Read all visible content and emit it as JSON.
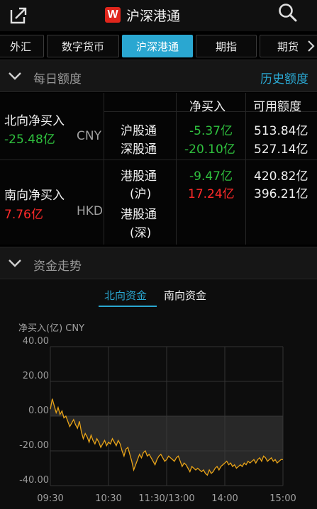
{
  "header": {
    "title": "沪深港通",
    "logo_letter": "W",
    "share_icon": "share-icon",
    "search_icon": "search-icon"
  },
  "tabs": [
    {
      "label": "外汇",
      "active": false
    },
    {
      "label": "数字货币",
      "active": false
    },
    {
      "label": "沪深港通",
      "active": true
    },
    {
      "label": "期指",
      "active": false
    },
    {
      "label": "期货",
      "active": false
    }
  ],
  "daily_quota": {
    "title": "每日额度",
    "history_link": "历史额度",
    "col_net_buy": "净买入",
    "col_available": "可用额度",
    "north": {
      "label": "北向净买入",
      "value": "-25.48亿",
      "currency": "CNY",
      "rows": [
        {
          "name": "沪股通",
          "net": "-5.37亿",
          "available": "513.84亿"
        },
        {
          "name": "深股通",
          "net": "-20.10亿",
          "available": "527.14亿"
        }
      ]
    },
    "south": {
      "label": "南向净买入",
      "value": "7.76亿",
      "currency": "HKD",
      "rows": [
        {
          "name_1": "港股通",
          "name_2": "(沪)",
          "net": "-9.47亿",
          "available": "420.82亿"
        },
        {
          "name_1": "港股通",
          "name_2": "(深)",
          "net": "17.24亿",
          "available": "396.21亿"
        }
      ]
    }
  },
  "fund_trend": {
    "title": "资金走势",
    "tabs": [
      {
        "label": "北向资金",
        "active": true
      },
      {
        "label": "南向资金",
        "active": false
      }
    ],
    "unit_label": "净买入(亿) CNY"
  },
  "chart_data": {
    "type": "area",
    "ylabel": "净买入(亿) CNY",
    "ylim": [
      -40,
      40
    ],
    "y_ticks": [
      "40.00",
      "20.00",
      "0.00",
      "-20.00",
      "-40.00"
    ],
    "y_tick_values": [
      40,
      20,
      0,
      -20,
      -40
    ],
    "x_ticks": [
      "09:30",
      "10:30",
      "11:30/13:00",
      "14:00",
      "15:00"
    ],
    "x_tick_minutes": [
      0,
      60,
      120,
      180,
      240
    ],
    "line_color": "#e8a317",
    "grid": true,
    "series": [
      {
        "x": [
          0,
          2,
          4,
          6,
          8,
          10,
          12,
          14,
          16,
          18,
          20,
          22,
          24,
          26,
          28,
          30,
          32,
          34,
          36,
          38,
          40,
          42,
          44,
          46,
          48,
          50,
          52,
          54,
          56,
          58,
          60,
          62,
          64,
          66,
          68,
          70,
          72,
          74,
          76,
          78,
          80,
          82,
          84,
          86,
          88,
          90,
          92,
          94,
          96,
          98,
          100,
          102,
          104,
          106,
          108,
          110,
          112,
          114,
          116,
          118,
          120,
          122,
          124,
          126,
          128,
          130,
          132,
          134,
          136,
          138,
          140,
          142,
          144,
          146,
          148,
          150,
          152,
          154,
          156,
          158,
          160,
          162,
          164,
          166,
          168,
          170,
          172,
          174,
          176,
          178,
          180,
          182,
          184,
          186,
          188,
          190,
          192,
          194,
          196,
          198,
          200,
          202,
          204,
          206,
          208,
          210,
          212,
          214,
          216,
          218,
          220,
          222,
          224,
          226,
          228,
          230,
          232,
          234,
          236,
          238,
          240
        ],
        "y": [
          4,
          10,
          6,
          2,
          5,
          1,
          3,
          -1,
          0,
          -3,
          -6,
          -4,
          -2,
          -5,
          -7,
          -3,
          -9,
          -13,
          -10,
          -12,
          -15,
          -11,
          -14,
          -16,
          -13,
          -15,
          -18,
          -16,
          -14,
          -17,
          -15,
          -16,
          -13,
          -15,
          -17,
          -14,
          -16,
          -20,
          -23,
          -19,
          -18,
          -22,
          -26,
          -31,
          -28,
          -25,
          -22,
          -24,
          -21,
          -20,
          -23,
          -22,
          -24,
          -26,
          -28,
          -25,
          -23,
          -22,
          -24,
          -26,
          -25,
          -23,
          -24,
          -25,
          -26,
          -24,
          -23,
          -26,
          -29,
          -27,
          -28,
          -30,
          -32,
          -29,
          -30,
          -31,
          -30,
          -31,
          -32,
          -31,
          -33,
          -34,
          -31,
          -33,
          -32,
          -30,
          -29,
          -31,
          -29,
          -28,
          -27,
          -26,
          -28,
          -27,
          -29,
          -28,
          -30,
          -29,
          -28,
          -29,
          -27,
          -28,
          -26,
          -27,
          -26,
          -25,
          -27,
          -25,
          -24,
          -26,
          -23,
          -24,
          -26,
          -25,
          -24,
          -26,
          -25,
          -27,
          -26,
          -25,
          -25
        ]
      }
    ]
  }
}
